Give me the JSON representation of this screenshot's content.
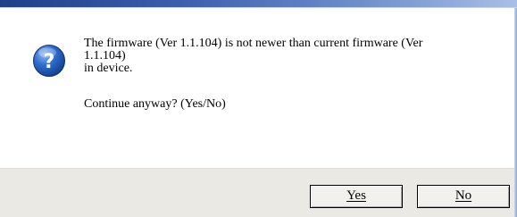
{
  "dialog": {
    "message_lines": [
      "The firmware (Ver 1.1.104) is not newer than current firmware (Ver",
      "1.1.104)",
      "in device."
    ],
    "prompt": "Continue anyway? (Yes/No)",
    "icon": "question-icon",
    "accent_color": "#1f57b5"
  },
  "buttons": {
    "yes_label": "Yes",
    "no_label": "No"
  }
}
